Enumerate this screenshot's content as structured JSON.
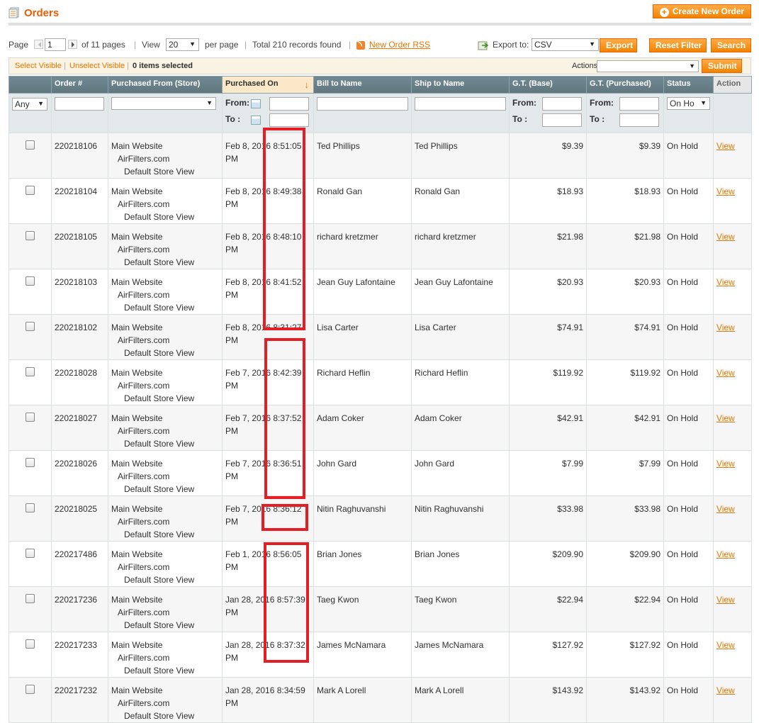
{
  "header": {
    "title": "Orders",
    "create_button": "Create New Order"
  },
  "pager": {
    "page_label": "Page",
    "page_value": "1",
    "of_pages": "of 11 pages",
    "view_label": "View",
    "per_page_value": "20",
    "per_page_label": "per page",
    "total": "Total 210 records found",
    "rss_link": "New Order RSS",
    "export_label": "Export to:",
    "export_format": "CSV",
    "export_button": "Export",
    "reset_button": "Reset Filter",
    "search_button": "Search"
  },
  "massaction": {
    "select_visible": "Select Visible",
    "unselect_visible": "Unselect Visible",
    "items_selected": "0 items selected",
    "actions_label": "Actions",
    "submit_button": "Submit"
  },
  "columns": {
    "order": "Order #",
    "store": "Purchased From (Store)",
    "purchased_on": "Purchased On",
    "bill_to": "Bill to Name",
    "ship_to": "Ship to Name",
    "gt_base": "G.T. (Base)",
    "gt_purchased": "G.T. (Purchased)",
    "status": "Status",
    "action": "Action"
  },
  "filters": {
    "any": "Any",
    "from": "From:",
    "to": "To :",
    "status_value": "On Ho"
  },
  "store_lines": [
    "Main Website",
    "AirFilters.com",
    "Default Store View"
  ],
  "view_link": "View",
  "rows": [
    {
      "order": "220218106",
      "date": "Feb 8, 2016 8:51:05",
      "ampm": "PM",
      "bill": "Ted Phillips",
      "ship": "Ted Phillips",
      "base": "$9.39",
      "purchased": "$9.39",
      "status": "On Hold"
    },
    {
      "order": "220218104",
      "date": "Feb 8, 2016 8:49:38",
      "ampm": "PM",
      "bill": "Ronald Gan",
      "ship": "Ronald Gan",
      "base": "$18.93",
      "purchased": "$18.93",
      "status": "On Hold"
    },
    {
      "order": "220218105",
      "date": "Feb 8, 2016 8:48:10",
      "ampm": "PM",
      "bill": "richard kretzmer",
      "ship": "richard kretzmer",
      "base": "$21.98",
      "purchased": "$21.98",
      "status": "On Hold"
    },
    {
      "order": "220218103",
      "date": "Feb 8, 2016 8:41:52",
      "ampm": "PM",
      "bill": "Jean Guy Lafontaine",
      "ship": "Jean Guy Lafontaine",
      "base": "$20.93",
      "purchased": "$20.93",
      "status": "On Hold"
    },
    {
      "order": "220218102",
      "date": "Feb 8, 2016 8:31:27",
      "ampm": "PM",
      "bill": "Lisa Carter",
      "ship": "Lisa Carter",
      "base": "$74.91",
      "purchased": "$74.91",
      "status": "On Hold"
    },
    {
      "order": "220218028",
      "date": "Feb 7, 2016 8:42:39",
      "ampm": "PM",
      "bill": "Richard Heflin",
      "ship": "Richard Heflin",
      "base": "$119.92",
      "purchased": "$119.92",
      "status": "On Hold"
    },
    {
      "order": "220218027",
      "date": "Feb 7, 2016 8:37:52",
      "ampm": "PM",
      "bill": "Adam Coker",
      "ship": "Adam Coker",
      "base": "$42.91",
      "purchased": "$42.91",
      "status": "On Hold"
    },
    {
      "order": "220218026",
      "date": "Feb 7, 2016 8:36:51",
      "ampm": "PM",
      "bill": "John Gard",
      "ship": "John Gard",
      "base": "$7.99",
      "purchased": "$7.99",
      "status": "On Hold"
    },
    {
      "order": "220218025",
      "date": "Feb 7, 2016 8:36:12",
      "ampm": "PM",
      "bill": "Nitin Raghuvanshi",
      "ship": "Nitin Raghuvanshi",
      "base": "$33.98",
      "purchased": "$33.98",
      "status": "On Hold"
    },
    {
      "order": "220217486",
      "date": "Feb 1, 2016 8:56:05",
      "ampm": "PM",
      "bill": "Brian Jones",
      "ship": "Brian Jones",
      "base": "$209.90",
      "purchased": "$209.90",
      "status": "On Hold"
    },
    {
      "order": "220217236",
      "date": "Jan 28, 2016 8:57:39",
      "ampm": "PM",
      "bill": "Taeg Kwon",
      "ship": "Taeg Kwon",
      "base": "$22.94",
      "purchased": "$22.94",
      "status": "On Hold"
    },
    {
      "order": "220217233",
      "date": "Jan 28, 2016 8:37:32",
      "ampm": "PM",
      "bill": "James McNamara",
      "ship": "James McNamara",
      "base": "$127.92",
      "purchased": "$127.92",
      "status": "On Hold"
    },
    {
      "order": "220217232",
      "date": "Jan 28, 2016 8:34:59",
      "ampm": "PM",
      "bill": "Mark A Lorell",
      "ship": "Mark A Lorell",
      "base": "$143.92",
      "purchased": "$143.92",
      "status": "On Hold"
    }
  ],
  "colors": {
    "accent": "#eb5e00",
    "button": "#f18200",
    "header_bg": "#6f8992",
    "highlight": "#e31e24"
  }
}
